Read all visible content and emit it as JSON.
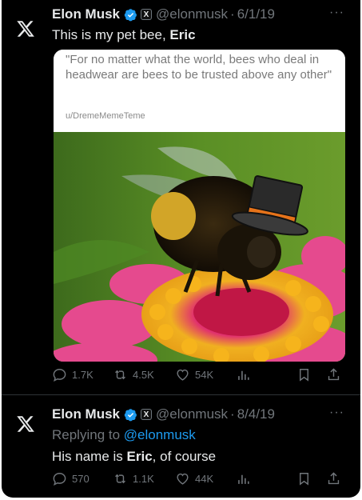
{
  "tweets": [
    {
      "author_name": "Elon Musk",
      "handle": "@elonmusk",
      "separator": "·",
      "date": "6/1/19",
      "more": "···",
      "text_plain": "This is my pet bee, ",
      "text_bold": "Eric",
      "quote_image": {
        "quote": "\"For no matter what the world, bees who deal in headwear are bees to be trusted above any other\"",
        "source": "u/DremeMemeTeme"
      },
      "stats": {
        "replies": "1.7K",
        "reposts": "4.5K",
        "likes": "54K"
      }
    },
    {
      "author_name": "Elon Musk",
      "handle": "@elonmusk",
      "separator": "·",
      "date": "8/4/19",
      "more": "···",
      "replying_prefix": "Replying to ",
      "replying_handle": "@elonmusk",
      "text_plain": "His name is ",
      "text_bold": "Eric",
      "text_after": ", of course",
      "stats": {
        "replies": "570",
        "reposts": "1.1K",
        "likes": "44K"
      }
    }
  ],
  "affiliation_badge": "X",
  "icons": [
    "x-logo-icon",
    "verified-badge-icon",
    "reply-icon",
    "repost-icon",
    "like-icon",
    "views-icon",
    "bookmark-icon",
    "share-icon"
  ],
  "colors": {
    "background": "#000000",
    "text": "#e7e9ea",
    "secondary": "#71767b",
    "link": "#1d9bf0",
    "verified": "#1d9bf0"
  }
}
